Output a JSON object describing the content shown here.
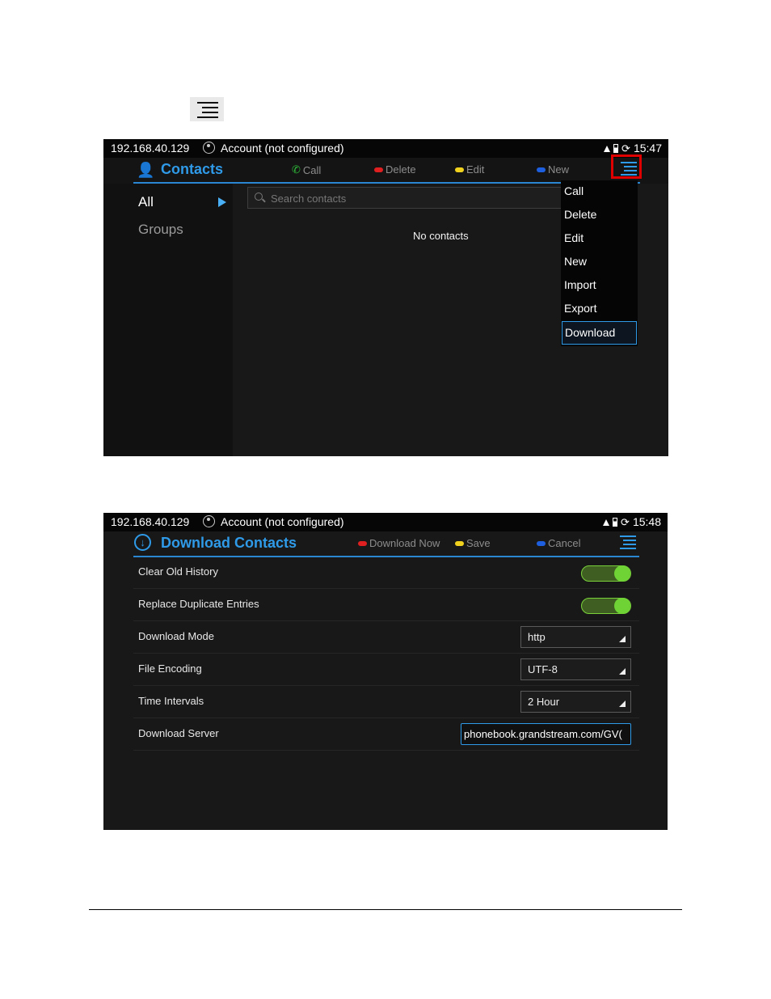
{
  "screen1": {
    "status": {
      "ip": "192.168.40.129",
      "account": "Account (not configured)",
      "time": "15:47"
    },
    "title": "Contacts",
    "softkeys": [
      {
        "label": "Call",
        "color": "#2ebd3a"
      },
      {
        "label": "Delete",
        "color": "#e02020"
      },
      {
        "label": "Edit",
        "color": "#f0d21e"
      },
      {
        "label": "New",
        "color": "#1e5fe0"
      }
    ],
    "sidebar": {
      "all": "All",
      "groups": "Groups"
    },
    "search_placeholder": "Search contacts",
    "empty_text": "No contacts",
    "menu": [
      "Call",
      "Delete",
      "Edit",
      "New",
      "Import",
      "Export",
      "Download"
    ],
    "menu_selected": "Download"
  },
  "screen2": {
    "status": {
      "ip": "192.168.40.129",
      "account": "Account (not configured)",
      "time": "15:48"
    },
    "title": "Download Contacts",
    "softkeys": [
      {
        "label": "Download Now",
        "color": "#e02020"
      },
      {
        "label": "Save",
        "color": "#f0d21e"
      },
      {
        "label": "Cancel",
        "color": "#1e5fe0"
      }
    ],
    "rows": [
      {
        "label": "Clear Old History",
        "type": "toggle",
        "on": true
      },
      {
        "label": "Replace Duplicate Entries",
        "type": "toggle",
        "on": true
      },
      {
        "label": "Download Mode",
        "type": "select",
        "value": "http"
      },
      {
        "label": "File Encoding",
        "type": "select",
        "value": "UTF-8"
      },
      {
        "label": "Time Intervals",
        "type": "select",
        "value": "2 Hour"
      },
      {
        "label": "Download Server",
        "type": "text",
        "value": "phonebook.grandstream.com/GV("
      }
    ]
  },
  "colors": {
    "accent": "#2f9ae8",
    "toggle_on": "#6fd336",
    "highlight": "#e00000"
  }
}
